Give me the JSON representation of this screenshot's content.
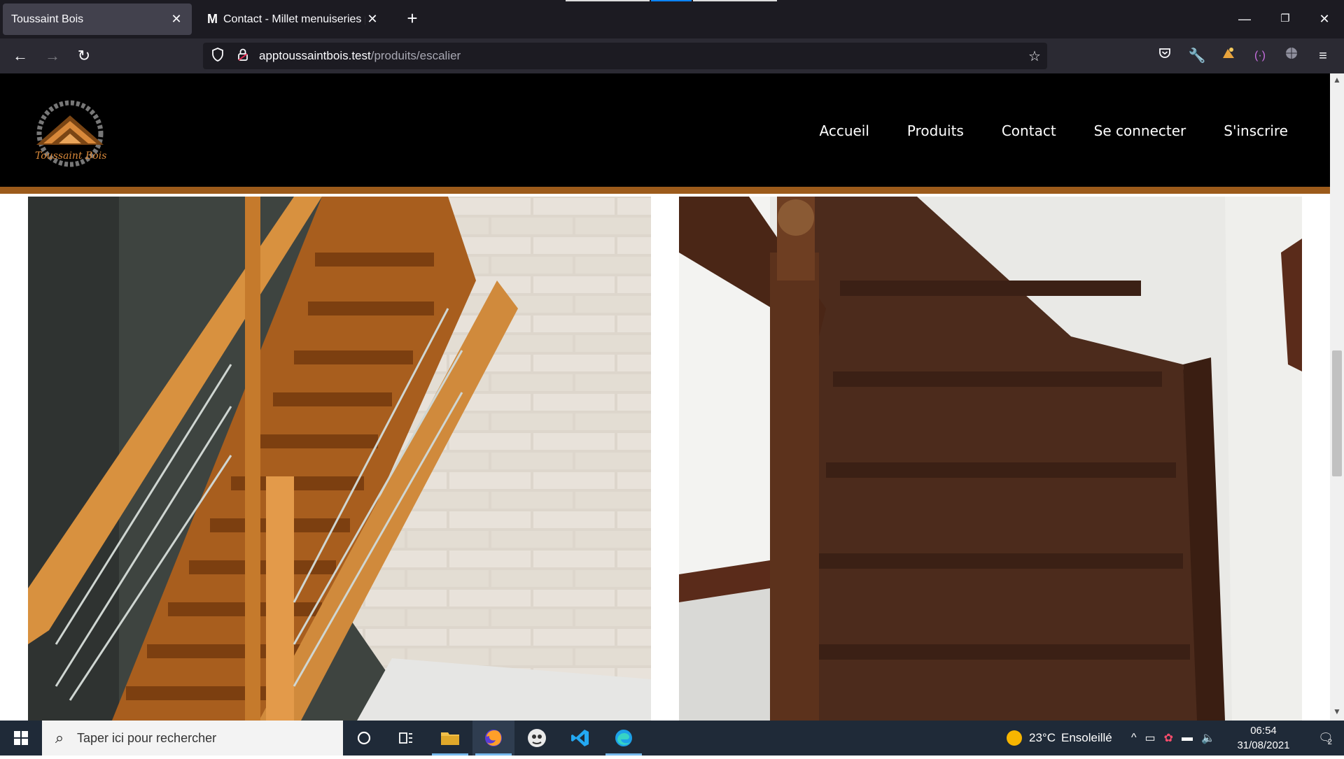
{
  "browser": {
    "tabs": [
      {
        "title": "Toussaint Bois",
        "active": true
      },
      {
        "title": "Contact - Millet menuiseries pour",
        "active": false
      }
    ],
    "url": {
      "host": "apptoussaintbois.test",
      "path": "/produits/escalier"
    }
  },
  "site": {
    "logo": {
      "line1": "Toussaint",
      "line2": "Bois"
    },
    "nav": [
      "Accueil",
      "Produits",
      "Contact",
      "Se connecter",
      "S'inscrire"
    ],
    "accent": "#9c5b1b"
  },
  "taskbar": {
    "search_placeholder": "Taper ici pour rechercher",
    "weather": {
      "temp": "23°C",
      "condition": "Ensoleillé"
    },
    "time": "06:54",
    "date": "31/08/2021",
    "notifications": "2"
  }
}
